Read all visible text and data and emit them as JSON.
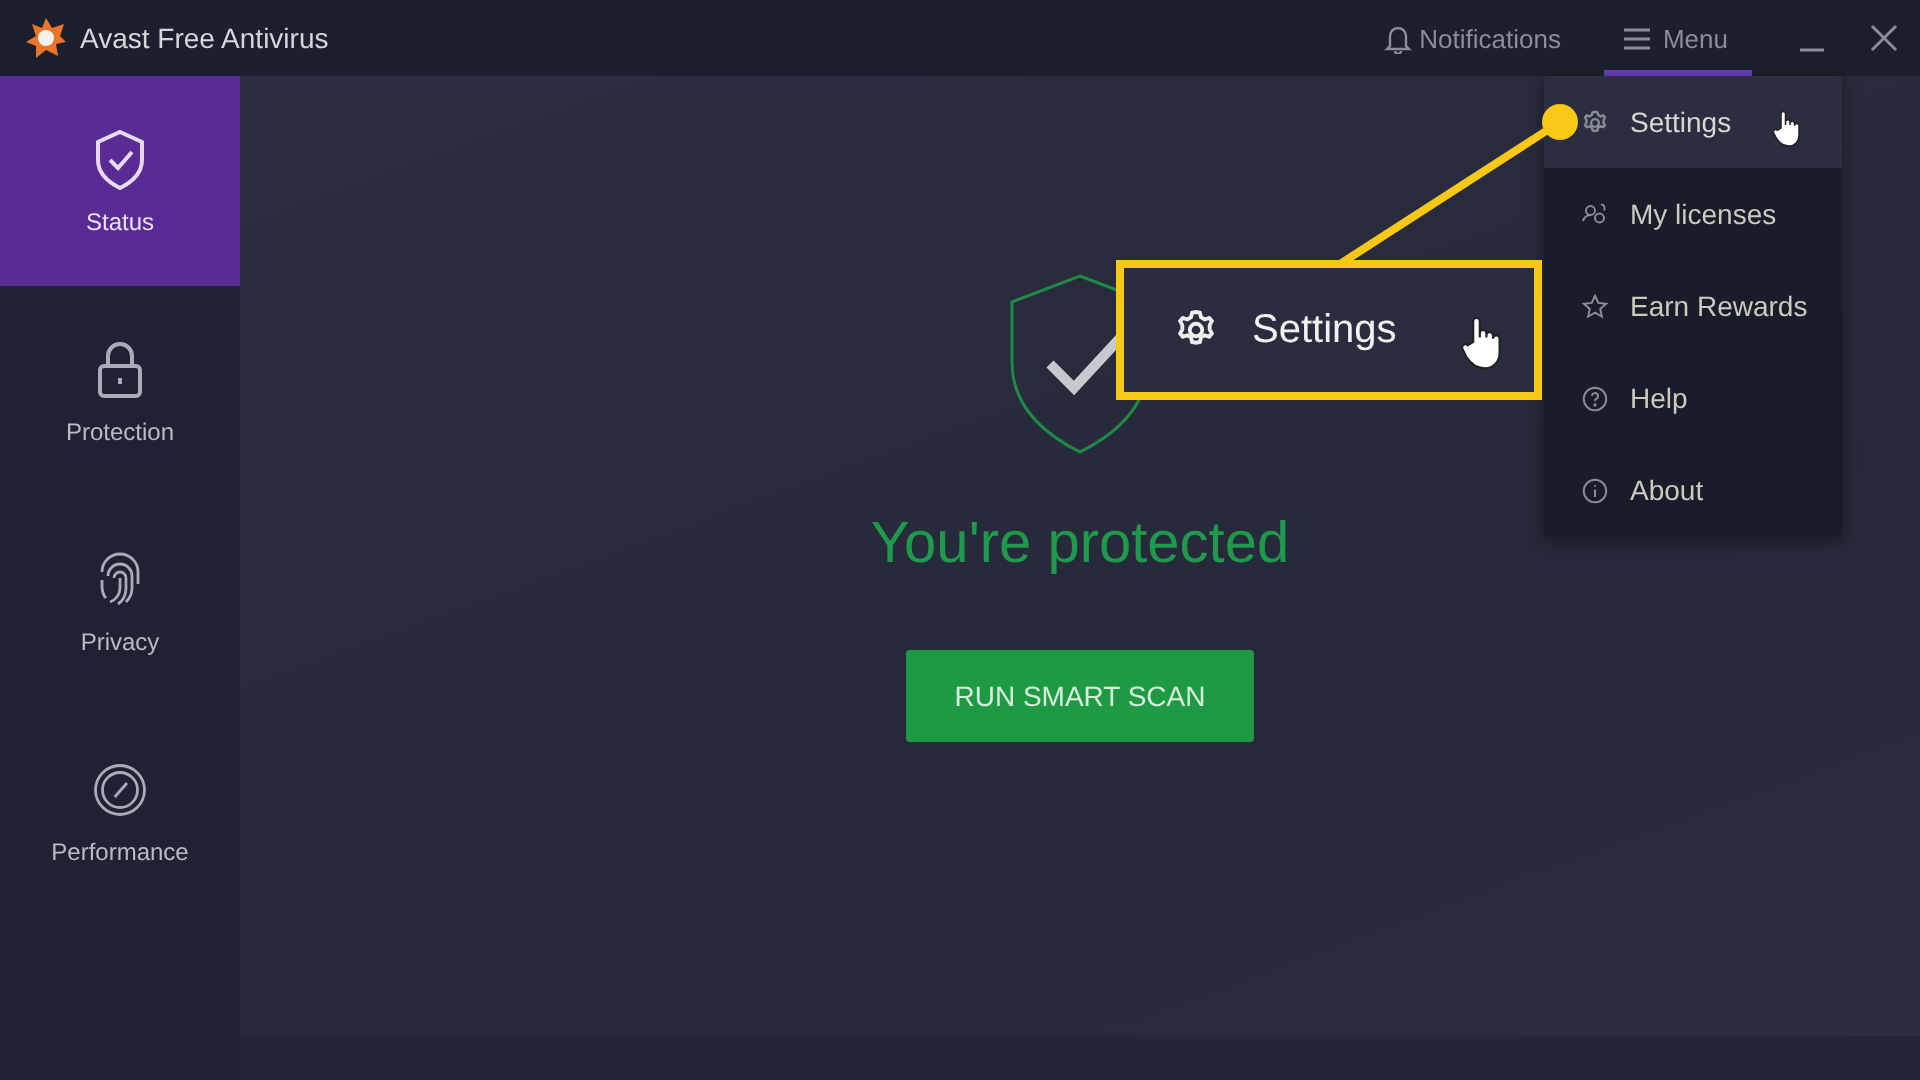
{
  "window": {
    "title": "Avast Free Antivirus"
  },
  "titlebar": {
    "notifications": "Notifications",
    "menu": {
      "label": "Menu",
      "selected": true
    }
  },
  "sidebar": {
    "items": [
      {
        "label": "Status",
        "kind": "shield",
        "selected": true
      },
      {
        "label": "Protection",
        "kind": "lock",
        "selected": false
      },
      {
        "label": "Privacy",
        "kind": "fingerprint",
        "selected": false
      },
      {
        "label": "Performance",
        "kind": "gauge",
        "selected": false
      }
    ]
  },
  "status": {
    "message": "You're protected",
    "button": "RUN SMART SCAN"
  },
  "menu": {
    "items": [
      {
        "label": "Settings",
        "kind": "gear",
        "selected": true
      },
      {
        "label": "My licenses",
        "kind": "people",
        "selected": false
      },
      {
        "label": "Earn Rewards",
        "kind": "star",
        "selected": false
      },
      {
        "label": "Help",
        "kind": "question",
        "selected": false
      },
      {
        "label": "About",
        "kind": "info",
        "selected": false
      }
    ]
  },
  "callout": {
    "label": "Settings"
  }
}
